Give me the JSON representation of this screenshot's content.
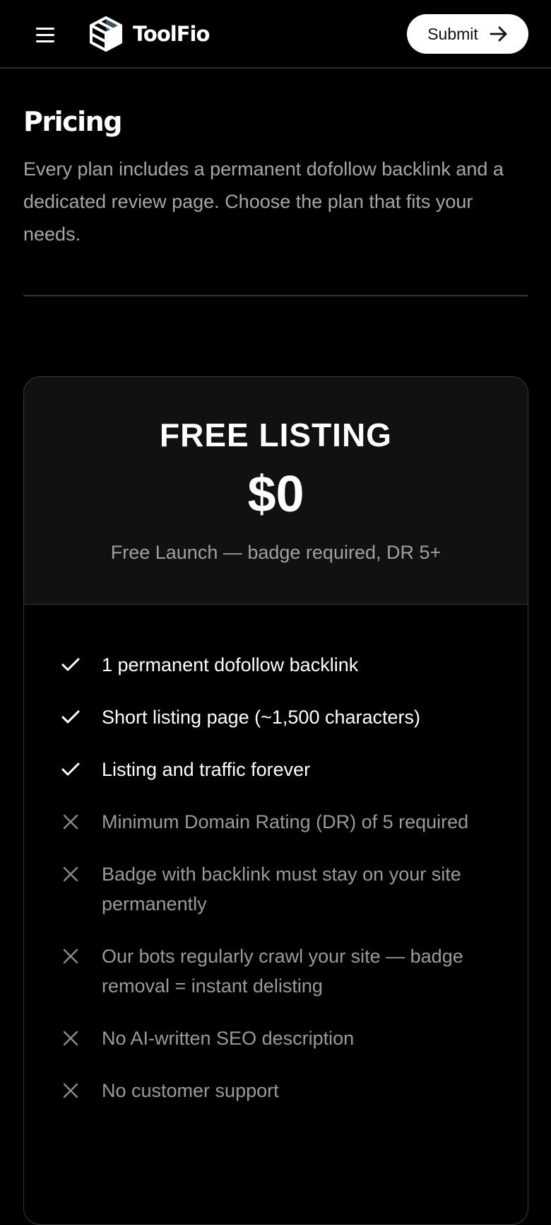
{
  "header": {
    "brand": "ToolFio",
    "submit_label": "Submit"
  },
  "intro": {
    "title": "Pricing",
    "description": "Every plan includes a permanent dofollow backlink and a dedicated review page. Choose the plan that fits your needs."
  },
  "plan": {
    "name": "FREE LISTING",
    "price": "$0",
    "note": "Free Launch — badge required, DR 5+",
    "features": [
      {
        "text": "1 permanent dofollow backlink",
        "included": true,
        "icon": "check-icon"
      },
      {
        "text": "Short listing page (~1,500 characters)",
        "included": true,
        "icon": "check-icon"
      },
      {
        "text": "Listing and traffic forever",
        "included": true,
        "icon": "check-icon"
      },
      {
        "text": "Minimum Domain Rating (DR) of 5 required",
        "included": false,
        "icon": "x-icon"
      },
      {
        "text": "Badge with backlink must stay on your site permanently",
        "included": false,
        "icon": "x-icon"
      },
      {
        "text": "Our bots regularly crawl your site — badge removal = instant delisting",
        "included": false,
        "icon": "x-icon"
      },
      {
        "text": "No AI-written SEO description",
        "included": false,
        "icon": "x-icon"
      },
      {
        "text": "No customer support",
        "included": false,
        "icon": "x-icon"
      }
    ]
  },
  "colors": {
    "background": "#000000",
    "card_header": "#111111",
    "muted_text": "#a6a6a6",
    "border": "#3a3a3a",
    "button_bg": "#ffffff"
  }
}
